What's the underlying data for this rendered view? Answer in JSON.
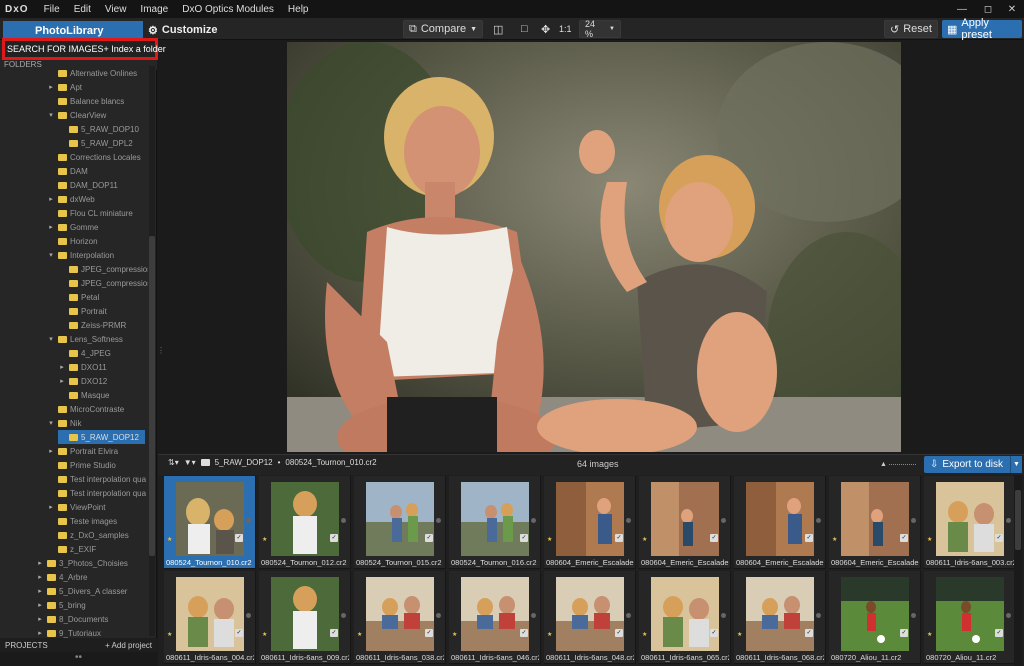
{
  "menubar": {
    "logo": "DxO",
    "items": [
      "File",
      "Edit",
      "View",
      "Image",
      "DxO Optics Modules",
      "Help"
    ]
  },
  "toolbar": {
    "tab_photolibrary": "PhotoLibrary",
    "tab_customize": "Customize",
    "compare_label": "Compare",
    "one_to_one": "1:1",
    "zoom_value": "24 %",
    "reset_label": "Reset",
    "apply_preset_label": "Apply preset"
  },
  "sidebar": {
    "search_label": "SEARCH FOR IMAGES",
    "index_folder_label": "+ Index a folder",
    "folders_header": "FOLDERS",
    "tree": [
      {
        "label": "Alternative Onlines",
        "indent": 1,
        "expander": ""
      },
      {
        "label": "Apt",
        "indent": 1,
        "expander": "▸"
      },
      {
        "label": "Balance blancs",
        "indent": 1,
        "expander": ""
      },
      {
        "label": "ClearView",
        "indent": 1,
        "expander": "▾"
      },
      {
        "label": "5_RAW_DOP10",
        "indent": 2,
        "expander": ""
      },
      {
        "label": "5_RAW_DPL2",
        "indent": 2,
        "expander": ""
      },
      {
        "label": "Corrections Locales",
        "indent": 1,
        "expander": ""
      },
      {
        "label": "DAM",
        "indent": 1,
        "expander": ""
      },
      {
        "label": "DAM_DOP11",
        "indent": 1,
        "expander": ""
      },
      {
        "label": "dxWeb",
        "indent": 1,
        "expander": "▸"
      },
      {
        "label": "Flou CL miniature",
        "indent": 1,
        "expander": ""
      },
      {
        "label": "Gomme",
        "indent": 1,
        "expander": "▸"
      },
      {
        "label": "Horizon",
        "indent": 1,
        "expander": ""
      },
      {
        "label": "Interpolation",
        "indent": 1,
        "expander": "▾"
      },
      {
        "label": "JPEG_compression",
        "indent": 2,
        "expander": ""
      },
      {
        "label": "JPEG_compression",
        "indent": 2,
        "expander": ""
      },
      {
        "label": "Petal",
        "indent": 2,
        "expander": ""
      },
      {
        "label": "Portrait",
        "indent": 2,
        "expander": ""
      },
      {
        "label": "Zeiss-PRMR",
        "indent": 2,
        "expander": ""
      },
      {
        "label": "Lens_Softness",
        "indent": 1,
        "expander": "▾"
      },
      {
        "label": "4_JPEG",
        "indent": 2,
        "expander": ""
      },
      {
        "label": "DXO11",
        "indent": 2,
        "expander": "▸"
      },
      {
        "label": "DXO12",
        "indent": 2,
        "expander": "▸"
      },
      {
        "label": "Masque",
        "indent": 2,
        "expander": ""
      },
      {
        "label": "MicroContraste",
        "indent": 1,
        "expander": ""
      },
      {
        "label": "Nik",
        "indent": 1,
        "expander": "▾"
      },
      {
        "label": "5_RAW_DOP12",
        "indent": 2,
        "expander": "",
        "selected": true
      },
      {
        "label": "Portrait Elvira",
        "indent": 1,
        "expander": "▸"
      },
      {
        "label": "Prime Studio",
        "indent": 1,
        "expander": ""
      },
      {
        "label": "Test interpolation qua",
        "indent": 1,
        "expander": ""
      },
      {
        "label": "Test interpolation qua",
        "indent": 1,
        "expander": ""
      },
      {
        "label": "ViewPoint",
        "indent": 1,
        "expander": "▸"
      },
      {
        "label": "Teste images",
        "indent": 1,
        "expander": ""
      },
      {
        "label": "z_DxO_samples",
        "indent": 1,
        "expander": ""
      },
      {
        "label": "z_EXIF",
        "indent": 1,
        "expander": ""
      },
      {
        "label": "3_Photos_Choisies",
        "indent": 0,
        "expander": "▸"
      },
      {
        "label": "4_Arbre",
        "indent": 0,
        "expander": "▸"
      },
      {
        "label": "5_Divers_A classer",
        "indent": 0,
        "expander": "▸"
      },
      {
        "label": "5_bring",
        "indent": 0,
        "expander": "▸"
      },
      {
        "label": "8_Documents",
        "indent": 0,
        "expander": "▸"
      },
      {
        "label": "9_Tutoriaux",
        "indent": 0,
        "expander": "▸"
      }
    ],
    "projects_label": "PROJECTS",
    "add_project_label": "+ Add project"
  },
  "filmstrip": {
    "folder": "5_RAW_DOP12",
    "current_file": "080524_Tournon_010.cr2",
    "image_count": "64 images",
    "export_label": "Export to disk",
    "thumbnails": [
      {
        "label": "080524_Tournon_010.cr2",
        "selected": true,
        "stars": "★",
        "scene": "a"
      },
      {
        "label": "080524_Tournon_012.cr2",
        "stars": "★",
        "scene": "b"
      },
      {
        "label": "080524_Tournon_015.cr2",
        "stars": "",
        "scene": "c"
      },
      {
        "label": "080524_Tournon_016.cr2",
        "stars": "",
        "scene": "c"
      },
      {
        "label": "080604_Emeric_Escalade...",
        "stars": "★",
        "scene": "d"
      },
      {
        "label": "080604_Emeric_Escalade...",
        "stars": "★",
        "scene": "e"
      },
      {
        "label": "080604_Emeric_Escalade...",
        "stars": "",
        "scene": "d"
      },
      {
        "label": "080604_Emeric_Escalade...",
        "stars": "★",
        "scene": "e"
      },
      {
        "label": "080611_Idris-6ans_003.cr2",
        "stars": "★",
        "scene": "f"
      },
      {
        "label": "080611_Idris-6ans_004.cr2",
        "stars": "★",
        "scene": "f"
      },
      {
        "label": "080611_Idris-6ans_009.cr2",
        "stars": "★",
        "scene": "b"
      },
      {
        "label": "080611_Idris-6ans_038.cr2",
        "stars": "★",
        "scene": "g"
      },
      {
        "label": "080611_Idris-6ans_046.cr2",
        "stars": "★",
        "scene": "g"
      },
      {
        "label": "080611_Idris-6ans_048.cr2",
        "stars": "★",
        "scene": "g"
      },
      {
        "label": "080611_Idris-6ans_065.cr2",
        "stars": "★",
        "scene": "f"
      },
      {
        "label": "080611_Idris-6ans_068.cr2",
        "stars": "★",
        "scene": "g"
      },
      {
        "label": "080720_Aliou_11.cr2",
        "stars": "",
        "scene": "h"
      },
      {
        "label": "080720_Aliou_11.cr2",
        "stars": "★",
        "scene": "h"
      }
    ]
  },
  "colors": {
    "accent": "#2b6fb0",
    "folder": "#e7c44a",
    "highlight_box": "#e01818"
  }
}
